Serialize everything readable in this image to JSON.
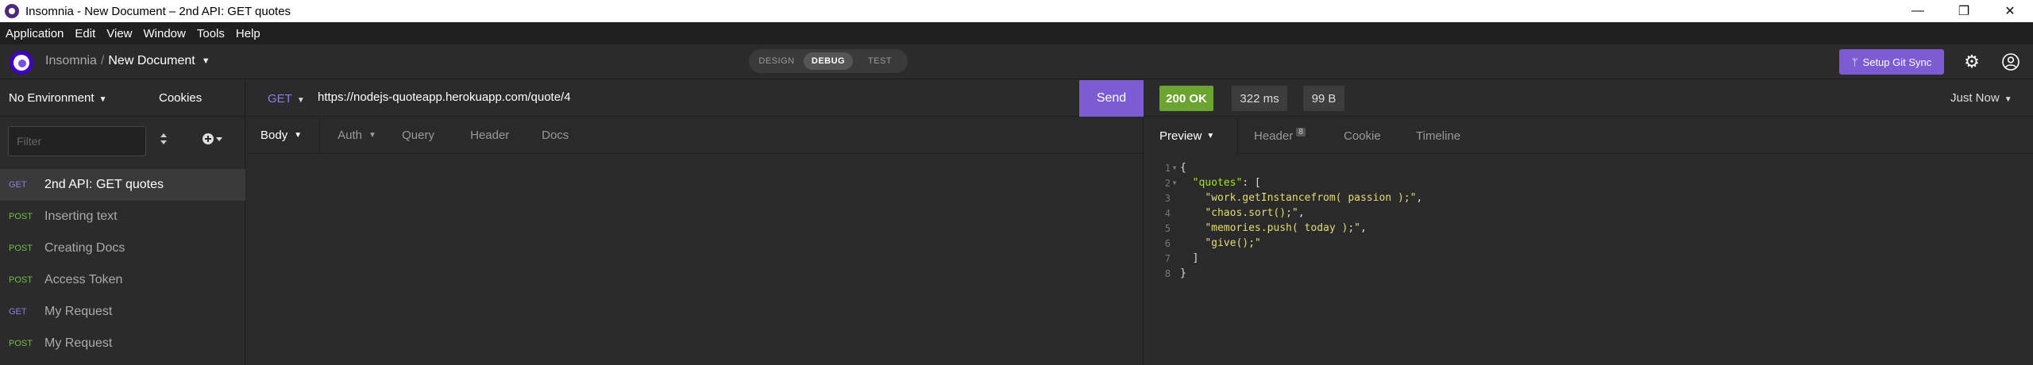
{
  "window": {
    "title": "Insomnia - New Document – 2nd API: GET quotes",
    "minimize_glyph": "—",
    "maximize_glyph": "❐",
    "close_glyph": "✕"
  },
  "menu": [
    "Application",
    "Edit",
    "View",
    "Window",
    "Tools",
    "Help"
  ],
  "header": {
    "workspace": "Insomnia",
    "separator": "/",
    "document": "New Document",
    "modes": [
      "DESIGN",
      "DEBUG",
      "TEST"
    ],
    "active_mode": "DEBUG",
    "git_sync_label": "Setup Git Sync",
    "git_icon": "ᛘ"
  },
  "sidebar": {
    "environment": "No Environment",
    "cookies": "Cookies",
    "filter_placeholder": "Filter",
    "requests": [
      {
        "method": "GET",
        "name": "2nd API: GET quotes",
        "active": true
      },
      {
        "method": "POST",
        "name": "Inserting text"
      },
      {
        "method": "POST",
        "name": "Creating Docs"
      },
      {
        "method": "POST",
        "name": "Access Token"
      },
      {
        "method": "GET",
        "name": "My Request"
      },
      {
        "method": "POST",
        "name": "My Request"
      }
    ]
  },
  "request": {
    "method": "GET",
    "url": "https://nodejs-quoteapp.herokuapp.com/quote/4",
    "send_label": "Send",
    "tabs": [
      "Body",
      "Auth",
      "Query",
      "Header",
      "Docs"
    ]
  },
  "response": {
    "status": "200 OK",
    "time": "322 ms",
    "size": "99 B",
    "history": "Just Now",
    "tabs": [
      "Preview",
      "Header",
      "Cookie",
      "Timeline"
    ],
    "header_count": "8",
    "lines": [
      {
        "no": "1",
        "fold": "▼",
        "text": "{"
      },
      {
        "no": "2",
        "fold": "▼",
        "indent": "  ",
        "key": "\"quotes\"",
        "text": ": ["
      },
      {
        "no": "3",
        "indent": "    ",
        "str": "\"work.getInstancefrom( passion );\"",
        "text": ","
      },
      {
        "no": "4",
        "indent": "    ",
        "str": "\"chaos.sort();\"",
        "text": ","
      },
      {
        "no": "5",
        "indent": "    ",
        "str": "\"memories.push( today );\"",
        "text": ","
      },
      {
        "no": "6",
        "indent": "    ",
        "str": "\"give();\"",
        "text": ""
      },
      {
        "no": "7",
        "indent": "  ",
        "text": "]"
      },
      {
        "no": "8",
        "text": "}"
      }
    ]
  },
  "colors": {
    "accent": "#7c5cd3",
    "status_ok": "#6ba431",
    "get_method": "#8f7ee6",
    "post_method": "#6cc04a"
  }
}
